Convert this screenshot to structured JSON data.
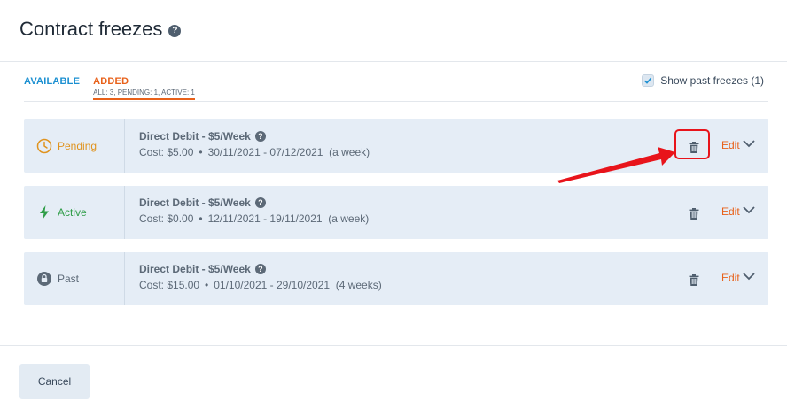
{
  "header": {
    "title": "Contract freezes",
    "help_glyph": "?"
  },
  "tabs": {
    "available": "AVAILABLE",
    "added": "ADDED",
    "added_sub": "ALL: 3, PENDING: 1, ACTIVE: 1"
  },
  "show_past": {
    "label": "Show past freezes (1)",
    "checked": true
  },
  "freezes": [
    {
      "status": "Pending",
      "status_icon": "clock-icon",
      "status_color": "#e0931e",
      "title": "Direct Debit - $5/Week",
      "cost": "Cost: $5.00",
      "dates": "30/11/2021 -  07/12/2021",
      "duration": "(a week)",
      "edit_label": "Edit"
    },
    {
      "status": "Active",
      "status_icon": "lightning-icon",
      "status_color": "#2f9d48",
      "title": "Direct Debit - $5/Week",
      "cost": "Cost: $0.00",
      "dates": "12/11/2021 -  19/11/2021",
      "duration": "(a week)",
      "edit_label": "Edit"
    },
    {
      "status": "Past",
      "status_icon": "lock-icon",
      "status_color": "#5c6977",
      "title": "Direct Debit - $5/Week",
      "cost": "Cost: $15.00",
      "dates": "01/10/2021 -  29/10/2021",
      "duration": "(4 weeks)",
      "edit_label": "Edit"
    }
  ],
  "footer": {
    "cancel_label": "Cancel"
  },
  "colors": {
    "accent_orange": "#e8611a",
    "accent_blue": "#1a8fd1",
    "annotation_red": "#e8141b",
    "card_bg": "#e5edf6"
  }
}
